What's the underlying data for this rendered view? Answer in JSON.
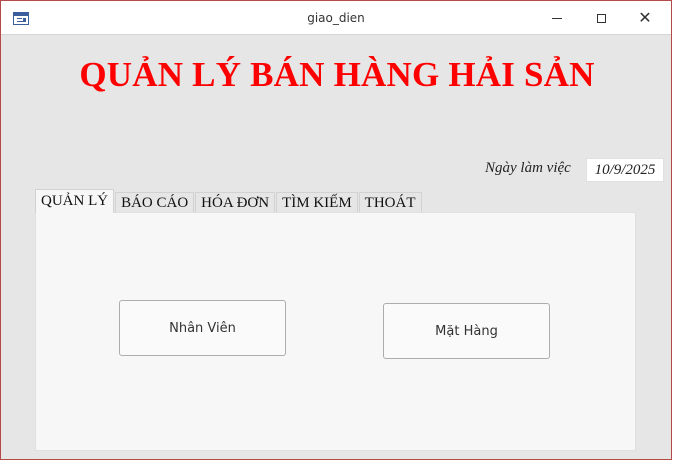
{
  "window": {
    "title": "giao_dien",
    "controls": {
      "minimize": "minimize-icon",
      "maximize": "maximize-icon",
      "close": "close-icon"
    },
    "app_icon": "form-icon"
  },
  "header": {
    "title": "QUẢN LÝ BÁN HÀNG HẢI SẢN",
    "title_color": "#ff0000"
  },
  "work_date": {
    "label": "Ngày làm việc",
    "value": "10/9/2025"
  },
  "tabs": [
    {
      "label": "QUẢN LÝ",
      "active": true
    },
    {
      "label": "BÁO CÁO",
      "active": false
    },
    {
      "label": "HÓA ĐƠN",
      "active": false
    },
    {
      "label": "TÌM KIẾM",
      "active": false
    },
    {
      "label": "THOÁT",
      "active": false
    }
  ],
  "tab_page": {
    "buttons": [
      {
        "label": "Nhân Viên"
      },
      {
        "label": "Mặt Hàng"
      }
    ]
  },
  "colors": {
    "border_accent": "#b44a4a",
    "background": "#e6e6e6"
  }
}
